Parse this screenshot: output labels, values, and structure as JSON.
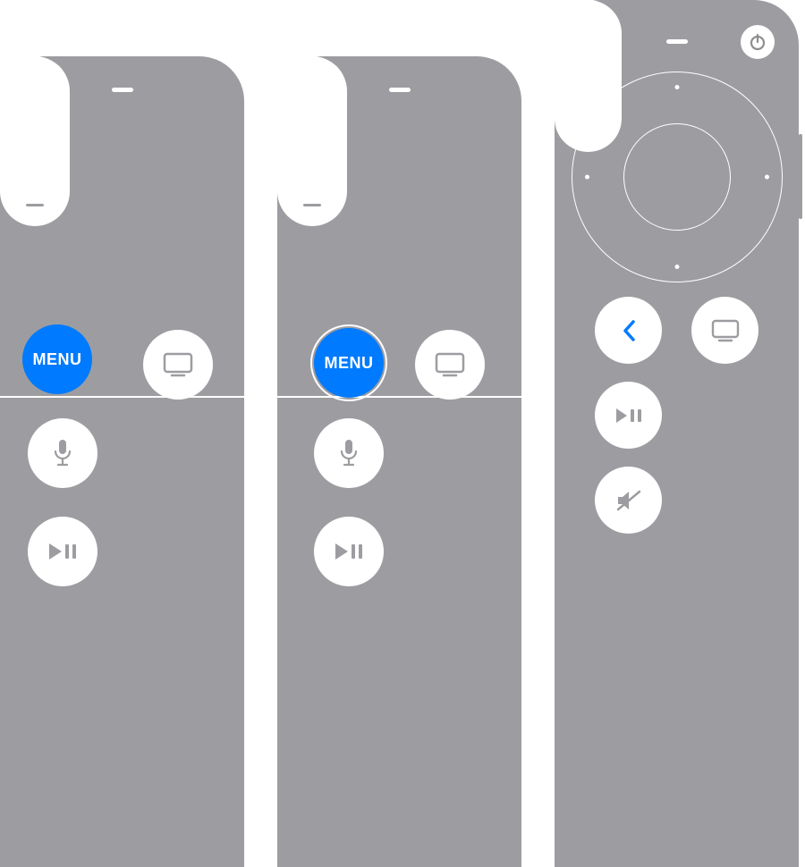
{
  "colors": {
    "body_gray": "#9d9da1",
    "accent_blue": "#007aff",
    "white": "#ffffff"
  },
  "remotes": [
    {
      "id": "siri-remote-gen1-a",
      "menu_label": "MENU",
      "menu_offset": true,
      "buttons": {
        "menu": {
          "type": "text",
          "highlighted": true
        },
        "tv": {
          "type": "tv-icon"
        },
        "mic": {
          "type": "mic-icon"
        },
        "play": {
          "type": "play-pause-icon"
        },
        "volume": {
          "plus": "+",
          "minus": "−"
        }
      }
    },
    {
      "id": "siri-remote-gen1-b",
      "menu_label": "MENU",
      "menu_offset": true,
      "buttons": {
        "menu": {
          "type": "text",
          "highlighted": true,
          "ring": true
        },
        "tv": {
          "type": "tv-icon"
        },
        "mic": {
          "type": "mic-icon"
        },
        "play": {
          "type": "play-pause-icon"
        },
        "volume": {
          "plus": "+",
          "minus": "−"
        }
      }
    },
    {
      "id": "siri-remote-gen2",
      "has_power": true,
      "has_clickwheel": true,
      "has_side_button": true,
      "buttons": {
        "back": {
          "type": "chevron-left-icon",
          "color": "blue"
        },
        "tv": {
          "type": "tv-icon"
        },
        "play": {
          "type": "play-pause-icon"
        },
        "mute": {
          "type": "mute-icon"
        },
        "volume": {
          "plus": "+",
          "minus": "−"
        }
      }
    }
  ]
}
